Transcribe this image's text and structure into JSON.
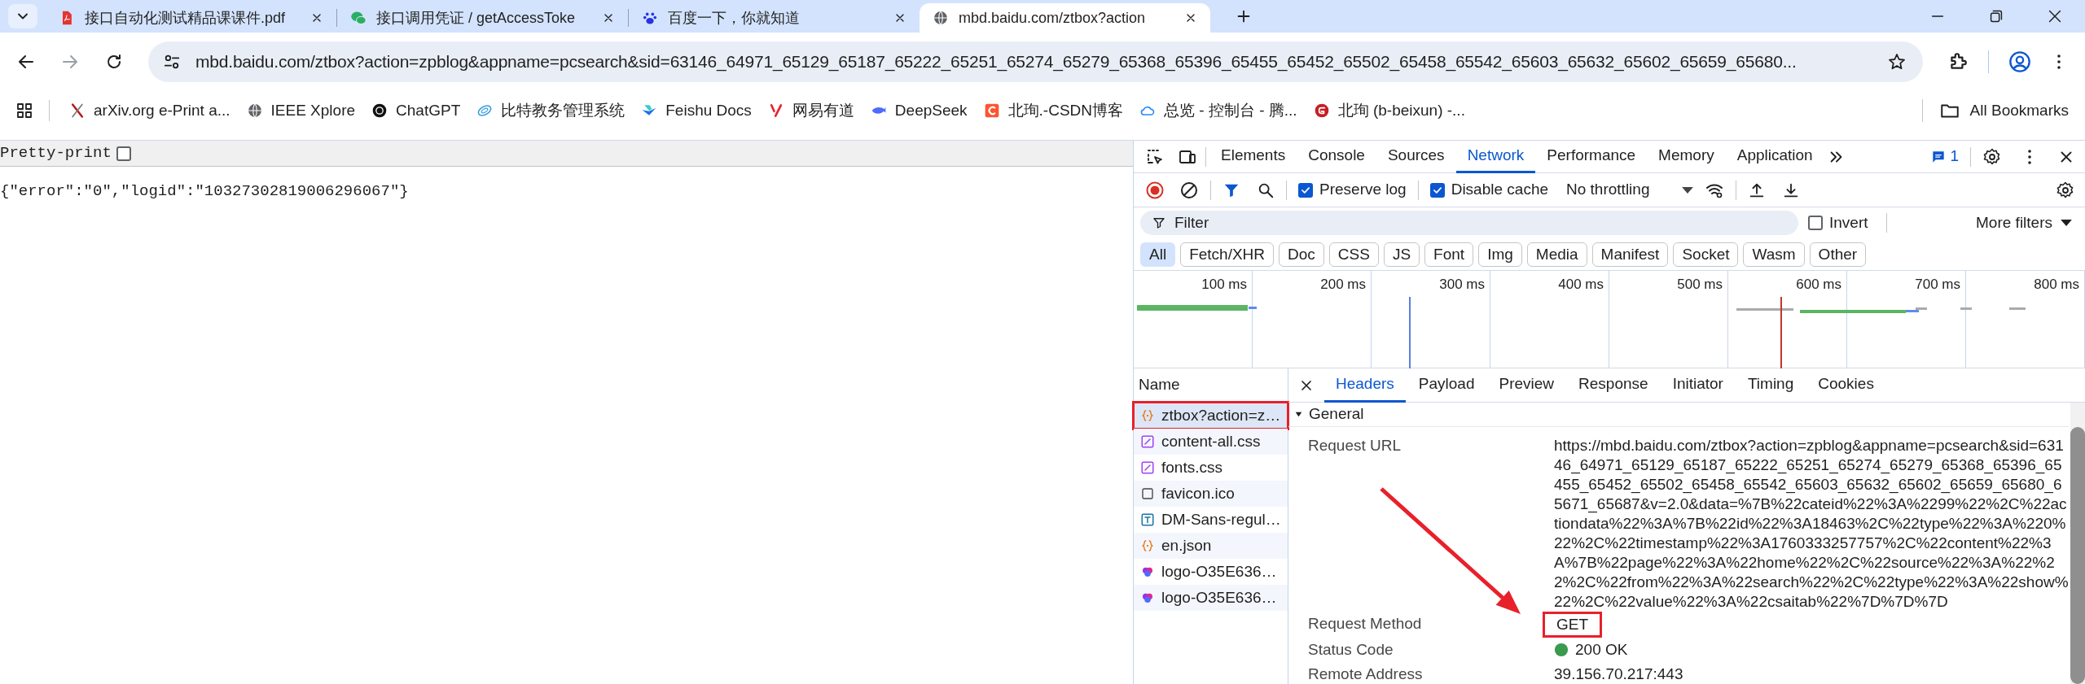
{
  "browser_tabs": [
    {
      "title": "接口自动化测试精品课课件.pdf",
      "kind": "pdf",
      "selected": false
    },
    {
      "title": "接口调用凭证 / getAccessToke",
      "kind": "chat",
      "selected": false
    },
    {
      "title": "百度一下，你就知道",
      "kind": "paw",
      "selected": false
    },
    {
      "title": "mbd.baidu.com/ztbox?action",
      "kind": "globe",
      "selected": true
    }
  ],
  "address_bar": {
    "url": "mbd.baidu.com/ztbox?action=zpblog&appname=pcsearch&sid=63146_64971_65129_65187_65222_65251_65274_65279_65368_65396_65455_65452_65502_65458_65542_65603_65632_65602_65659_65680..."
  },
  "bookmarks": [
    {
      "label": "arXiv.org e-Print a...",
      "kind": "arxiv"
    },
    {
      "label": "IEEE Xplore",
      "kind": "globe"
    },
    {
      "label": "ChatGPT",
      "kind": "ring"
    },
    {
      "label": "比特教务管理系统",
      "kind": "leaf"
    },
    {
      "label": "Feishu Docs",
      "kind": "wing"
    },
    {
      "label": "网易有道",
      "kind": "fork"
    },
    {
      "label": "DeepSeek",
      "kind": "whale"
    },
    {
      "label": "北珣.-CSDN博客",
      "kind": "square"
    },
    {
      "label": "总览 - 控制台 - 腾...",
      "kind": "cloud"
    },
    {
      "label": "北珣 (b-beixun) -...",
      "kind": "disc"
    }
  ],
  "all_bookmarks": "All Bookmarks",
  "page": {
    "pretty_print": {
      "label": "Pretty-print",
      "checked": false
    },
    "body": "{\"error\":\"0\",\"logid\":\"10327302819006296067\"}"
  },
  "devtools": {
    "panel_tabs": [
      {
        "label": "Elements",
        "selected": false
      },
      {
        "label": "Console",
        "selected": false
      },
      {
        "label": "Sources",
        "selected": false
      },
      {
        "label": "Network",
        "selected": true
      },
      {
        "label": "Performance",
        "selected": false
      },
      {
        "label": "Memory",
        "selected": false
      },
      {
        "label": "Application",
        "selected": false
      }
    ],
    "issues_count": "1",
    "preserve_log": {
      "label": "Preserve log",
      "checked": true
    },
    "disable_cache": {
      "label": "Disable cache",
      "checked": true
    },
    "throttling": "No throttling",
    "filter": {
      "placeholder": "Filter"
    },
    "invert": {
      "label": "Invert",
      "checked": false
    },
    "more_filters": "More filters",
    "type_filters": [
      {
        "label": "All",
        "selected": true
      },
      {
        "label": "Fetch/XHR",
        "selected": false
      },
      {
        "label": "Doc",
        "selected": false
      },
      {
        "label": "CSS",
        "selected": false
      },
      {
        "label": "JS",
        "selected": false
      },
      {
        "label": "Font",
        "selected": false
      },
      {
        "label": "Img",
        "selected": false
      },
      {
        "label": "Media",
        "selected": false
      },
      {
        "label": "Manifest",
        "selected": false
      },
      {
        "label": "Socket",
        "selected": false
      },
      {
        "label": "Wasm",
        "selected": false
      },
      {
        "label": "Other",
        "selected": false
      }
    ],
    "timeline_ticks": [
      "100 ms",
      "200 ms",
      "300 ms",
      "400 ms",
      "500 ms",
      "600 ms",
      "700 ms",
      "800 ms"
    ],
    "requests_header": "Name",
    "requests": [
      {
        "name": "ztbox?action=z…",
        "kind": "json",
        "selected": true,
        "annotated": true
      },
      {
        "name": "content-all.css",
        "kind": "css",
        "selected": false,
        "annotated": false
      },
      {
        "name": "fonts.css",
        "kind": "css",
        "selected": false,
        "annotated": false
      },
      {
        "name": "favicon.ico",
        "kind": "file",
        "selected": false,
        "annotated": false
      },
      {
        "name": "DM-Sans-regul…",
        "kind": "font",
        "selected": false,
        "annotated": false
      },
      {
        "name": "en.json",
        "kind": "json",
        "selected": false,
        "annotated": false
      },
      {
        "name": "logo-O35E636…",
        "kind": "image",
        "selected": false,
        "annotated": false
      },
      {
        "name": "logo-O35E636…",
        "kind": "image",
        "selected": false,
        "annotated": false
      }
    ],
    "detail_tabs": [
      {
        "label": "Headers",
        "selected": true
      },
      {
        "label": "Payload",
        "selected": false
      },
      {
        "label": "Preview",
        "selected": false
      },
      {
        "label": "Response",
        "selected": false
      },
      {
        "label": "Initiator",
        "selected": false
      },
      {
        "label": "Timing",
        "selected": false
      },
      {
        "label": "Cookies",
        "selected": false
      }
    ],
    "section": {
      "title": "General",
      "expanded": true,
      "rows": [
        {
          "label": "Request URL",
          "value": "https://mbd.baidu.com/ztbox?action=zpblog&appname=pcsearch&sid=63146_64971_65129_65187_65222_65251_65274_65279_65368_65396_65455_65452_65502_65458_65542_65603_65632_65602_65659_65680_65671_65687&v=2.0&data=%7B%22cateid%22%3A%2299%22%2C%22actiondata%22%3A%7B%22id%22%3A18463%2C%22type%22%3A%220%22%2C%22timestamp%22%3A1760333257757%2C%22content%22%3A%7B%22page%22%3A%22home%22%2C%22source%22%3A%22%22%2C%22from%22%3A%22search%22%2C%22type%22%3A%22show%22%2C%22value%22%3A%22csaitab%22%7D%7D%7D",
          "kind": "text",
          "annotated": false
        },
        {
          "label": "Request Method",
          "value": "GET",
          "kind": "text",
          "annotated": true
        },
        {
          "label": "Status Code",
          "value": "200 OK",
          "kind": "status",
          "annotated": false
        },
        {
          "label": "Remote Address",
          "value": "39.156.70.217:443",
          "kind": "text",
          "annotated": false
        }
      ]
    }
  }
}
